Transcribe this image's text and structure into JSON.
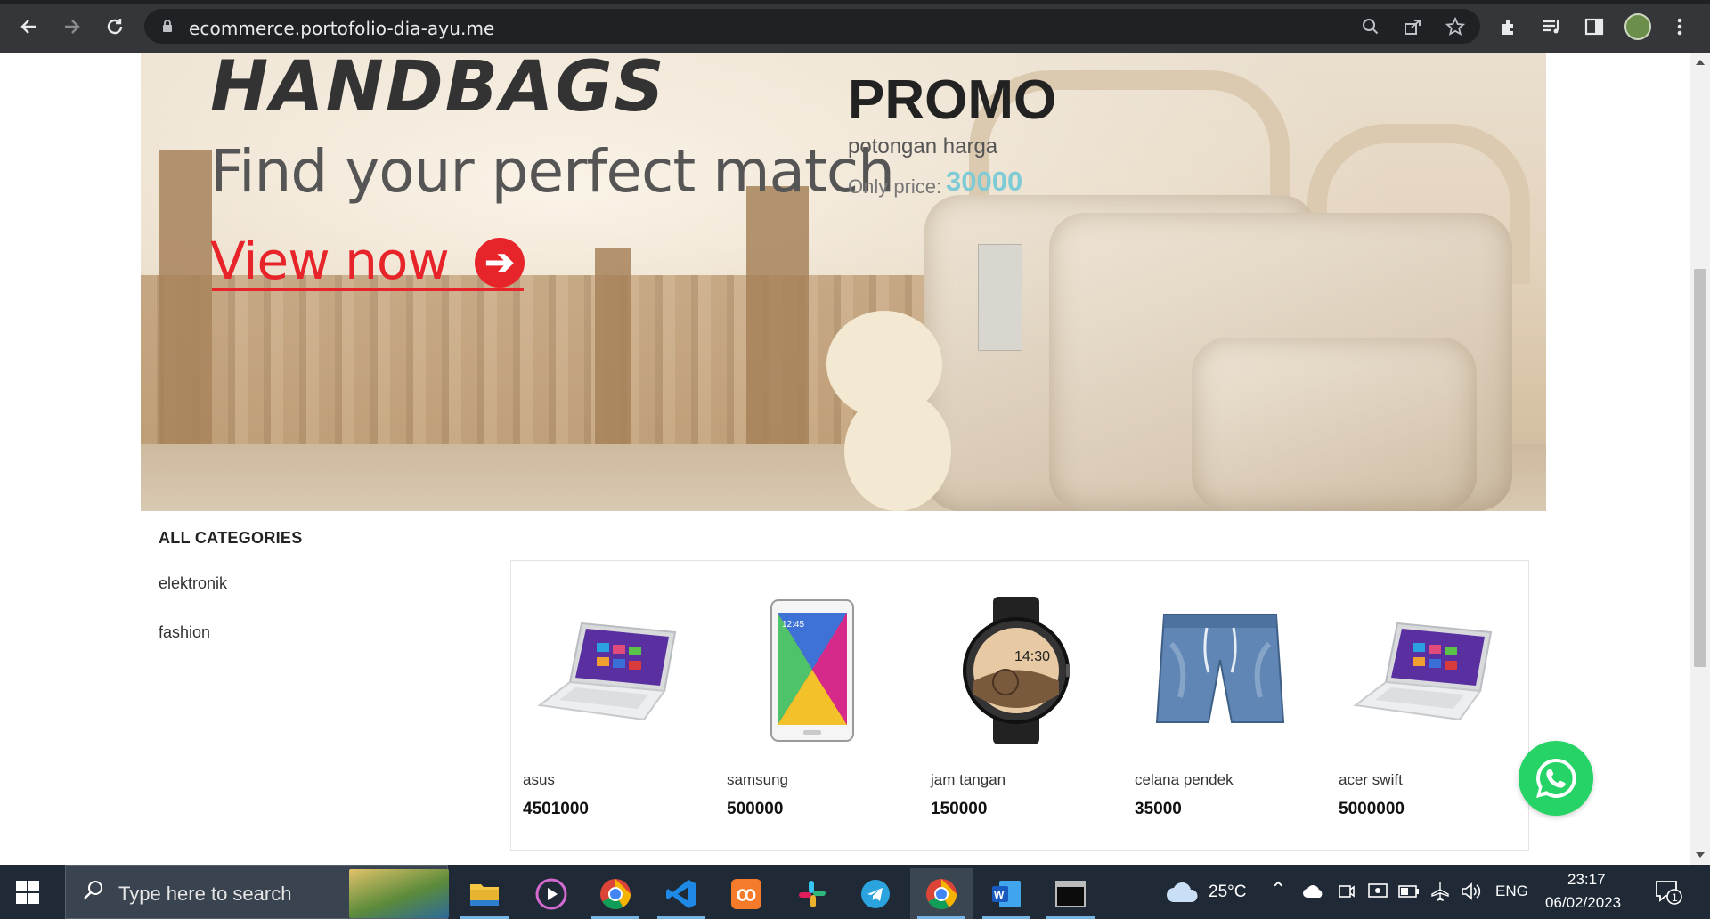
{
  "browser": {
    "url": "ecommerce.portofolio-dia-ayu.me"
  },
  "banner": {
    "headline": "HANDBAGS",
    "subline": "Find your perfect match",
    "cta": "View now",
    "promo_title": "PROMO",
    "promo_subtitle": "potongan harga",
    "promo_price_label": "Only price:",
    "promo_price": "30000"
  },
  "categories": {
    "title": "ALL CATEGORIES",
    "items": [
      "elektronik",
      "fashion"
    ]
  },
  "products": [
    {
      "name": "asus",
      "price": "4501000",
      "icon": "laptop-icon"
    },
    {
      "name": "samsung",
      "price": "500000",
      "icon": "tablet-icon"
    },
    {
      "name": "jam tangan",
      "price": "150000",
      "icon": "watch-icon"
    },
    {
      "name": "celana pendek",
      "price": "35000",
      "icon": "shorts-icon"
    },
    {
      "name": "acer swift",
      "price": "5000000",
      "icon": "laptop-icon"
    }
  ],
  "watch_display": {
    "time": "14:30"
  },
  "tablet_display": {
    "time": "12:45"
  },
  "taskbar": {
    "search_placeholder": "Type here to search",
    "weather": "25°C",
    "language": "ENG",
    "time": "23:17",
    "date": "06/02/2023",
    "notifications": "1"
  },
  "colors": {
    "browser_bar": "#35363a",
    "omnibox": "#202124",
    "promo_price": "#7ecbd6",
    "cta_red": "#e8242b",
    "whatsapp": "#25d366",
    "taskbar": "#1f2a36"
  }
}
